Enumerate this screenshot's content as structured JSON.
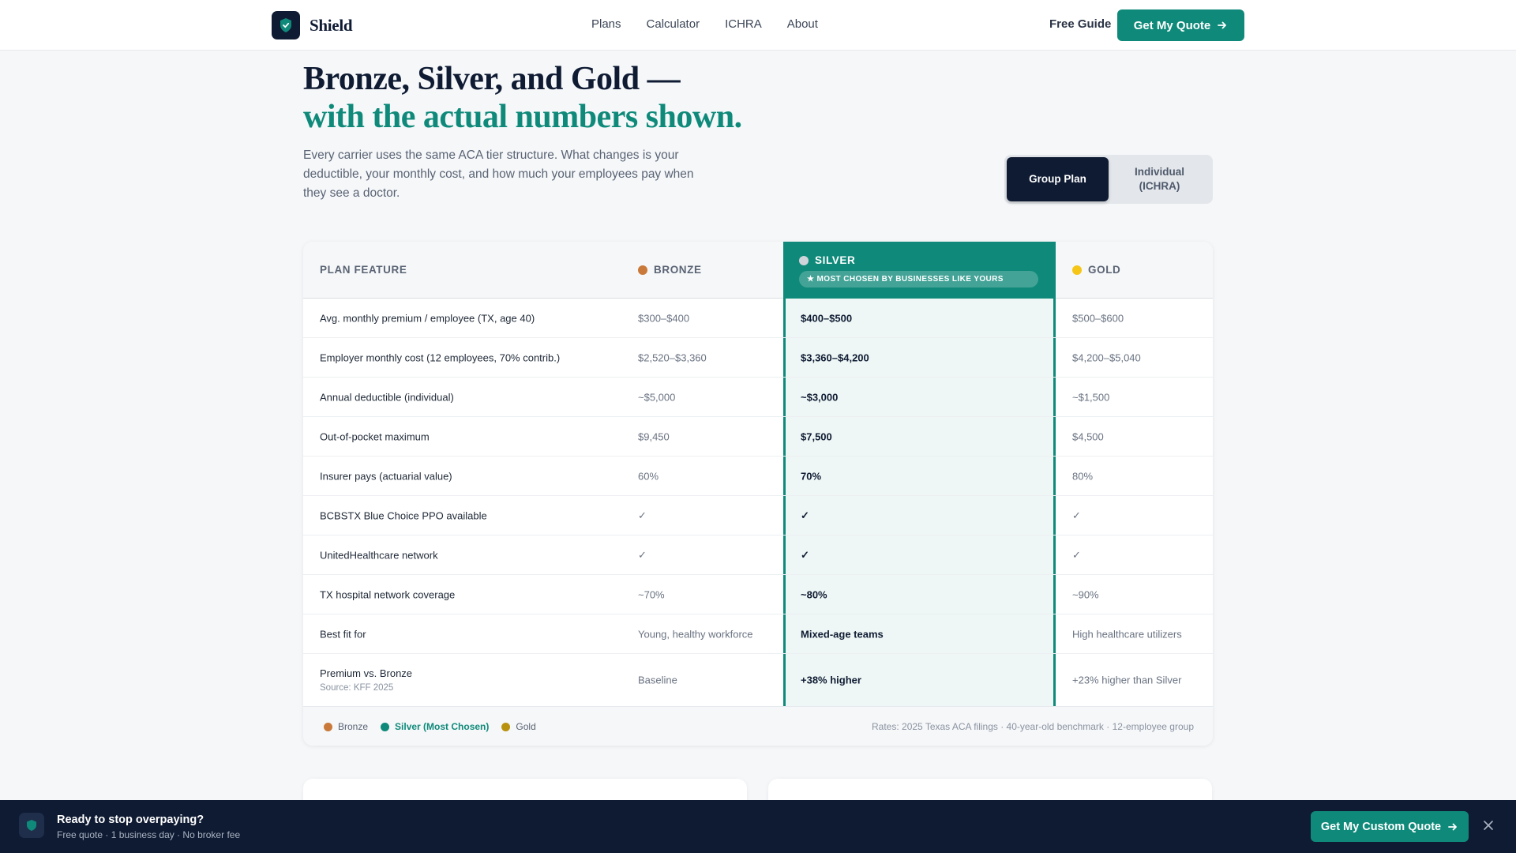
{
  "nav": {
    "logo_text": "Shield",
    "links": [
      "Plans",
      "Calculator",
      "ICHRA",
      "About"
    ],
    "free_guide": "Free Guide",
    "quote_button": "Get My Quote"
  },
  "hero": {
    "title_line1": "Bronze, Silver, and Gold —",
    "title_line2": "with the actual numbers shown.",
    "lede": "Every carrier uses the same ACA tier structure. What changes is your deductible, your monthly cost, and how much your employees pay when they see a doctor."
  },
  "toggle": {
    "option_group": "Group Plan",
    "option_individual_line1": "Individual",
    "option_individual_line2": "(ICHRA)",
    "selected": "Group Plan"
  },
  "table": {
    "headers": {
      "feature": "PLAN FEATURE",
      "bronze": "BRONZE",
      "silver": "SILVER",
      "silver_badge": "★ MOST CHOSEN BY BUSINESSES LIKE YOURS",
      "gold": "GOLD"
    },
    "rows": [
      {
        "feature": "Avg. monthly premium / employee (TX, age 40)",
        "bronze": "$300–$400",
        "silver": "$400–$500",
        "gold": "$500–$600"
      },
      {
        "feature": "Employer monthly cost (12 employees, 70% contrib.)",
        "bronze": "$2,520–$3,360",
        "silver": "$3,360–$4,200",
        "gold": "$4,200–$5,040"
      },
      {
        "feature": "Annual deductible (individual)",
        "bronze": "~$5,000",
        "silver": "~$3,000",
        "gold": "~$1,500"
      },
      {
        "feature": "Out-of-pocket maximum",
        "bronze": "$9,450",
        "silver": "$7,500",
        "gold": "$4,500"
      },
      {
        "feature": "Insurer pays (actuarial value)",
        "bronze": "60%",
        "silver": "70%",
        "gold": "80%"
      },
      {
        "feature": "BCBSTX Blue Choice PPO available",
        "bronze": "✓",
        "silver": "✓",
        "gold": "✓"
      },
      {
        "feature": "UnitedHealthcare network",
        "bronze": "✓",
        "silver": "✓",
        "gold": "✓"
      },
      {
        "feature": "TX hospital network coverage",
        "bronze": "~70%",
        "silver": "~80%",
        "gold": "~90%"
      },
      {
        "feature": "Best fit for",
        "bronze": "Young, healthy workforce",
        "silver": "Mixed-age teams",
        "gold": "High healthcare utilizers"
      },
      {
        "feature": "Premium vs. Bronze",
        "feature_sub": "Source: KFF 2025",
        "bronze": "Baseline",
        "silver": "+38% higher",
        "gold": "+23% higher than Silver"
      }
    ],
    "legend": {
      "bronze": "Bronze",
      "silver": "Silver (Most Chosen)",
      "gold": "Gold"
    },
    "rates_note": "Rates: 2025 Texas ACA filings · 40-year-old benchmark · 12-employee group"
  },
  "colors": {
    "brand_teal": "#0f8a7a",
    "navy": "#0f1b33",
    "bronze_dot": "#c97a3a",
    "silver_dot": "#cfd4da",
    "gold_dot": "#f5c518",
    "legend_silver": "#0f8a7a",
    "legend_gold": "#b8920f"
  },
  "sticky_bar": {
    "title": "Ready to stop overpaying?",
    "subtitle": "Free quote · 1 business day · No broker fee",
    "button": "Get My Custom Quote",
    "close_icon": "close-icon"
  }
}
